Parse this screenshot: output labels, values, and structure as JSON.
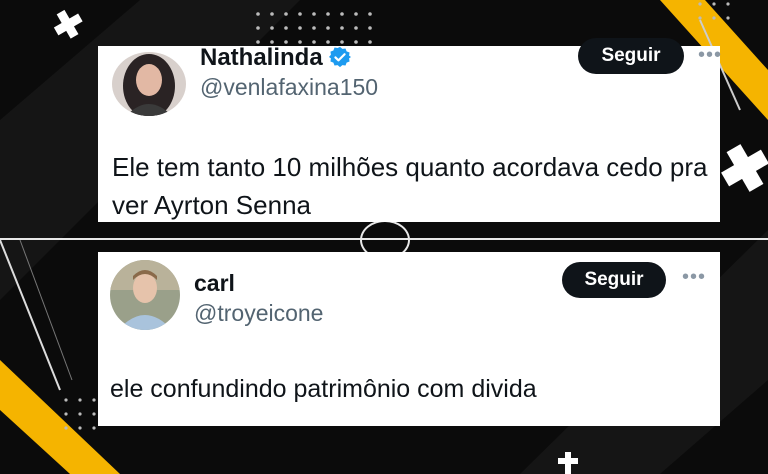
{
  "posts": [
    {
      "name": "Nathalinda",
      "verified": true,
      "handle": "@venlafaxina150",
      "follow_label": "Seguir",
      "more_label": "•••",
      "text": "Ele tem tanto 10 milhões quanto acordava cedo pra ver Ayrton Senna"
    },
    {
      "name": "carl",
      "verified": false,
      "handle": "@troyeicone",
      "follow_label": "Seguir",
      "more_label": "•••",
      "text": "ele confundindo patrimônio com divida"
    }
  ],
  "colors": {
    "background": "#0b0b0b",
    "accent_yellow": "#f5b400",
    "verified_blue": "#1d9bf0",
    "button_bg": "#0f1419"
  }
}
